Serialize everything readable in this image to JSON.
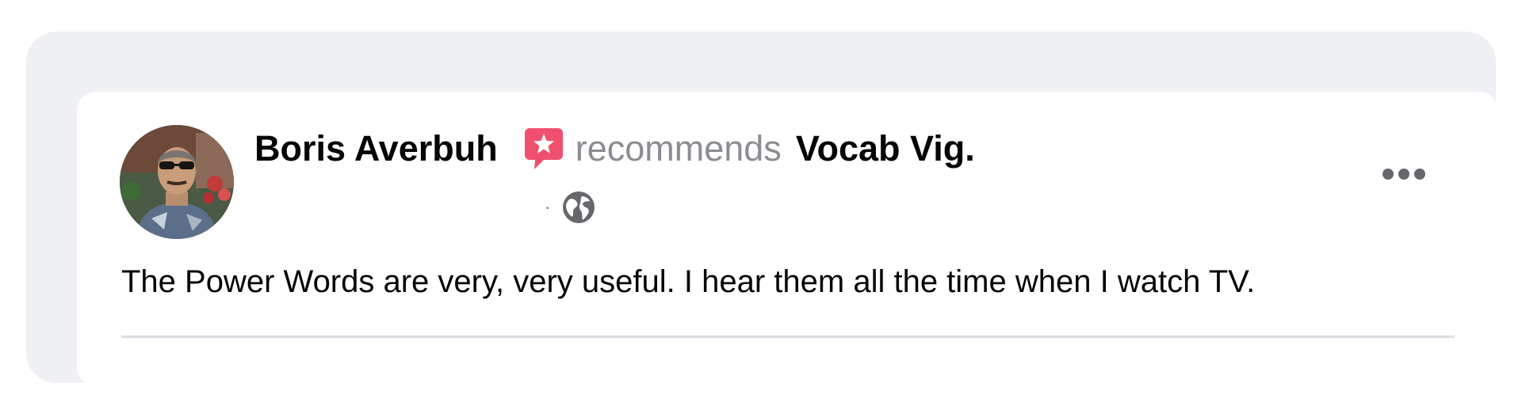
{
  "post": {
    "author_name": "Boris Averbuh",
    "verb": "recommends",
    "page_name": "Vocab Vig.",
    "meta_separator": "·",
    "body": "The Power Words are very, very useful. I hear them all the time when I watch TV.",
    "privacy_icon": "globe-icon",
    "recommend_icon": "recommend-star-icon",
    "more_icon": "more-options-icon"
  },
  "colors": {
    "recommend_badge": "#f0506e",
    "verb_gray": "#8a8d91",
    "frame_bg": "#eff0f3",
    "icon_gray": "#65676b"
  }
}
